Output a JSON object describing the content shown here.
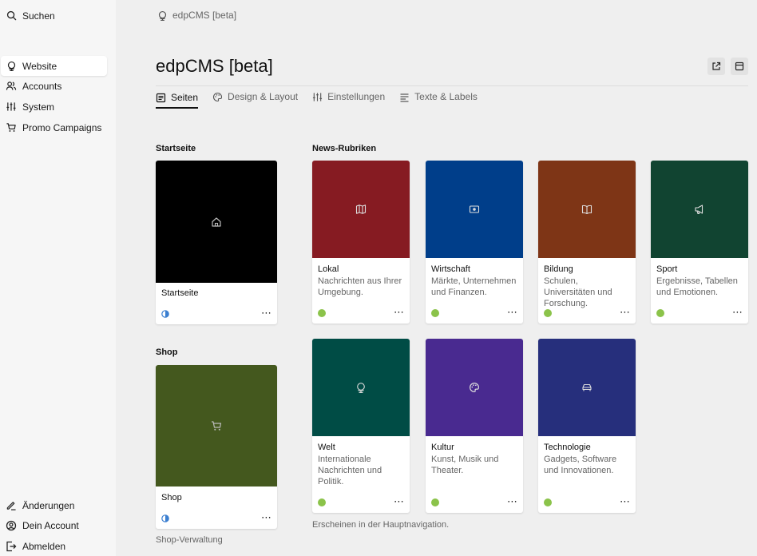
{
  "sidebar": {
    "search_label": "Suchen",
    "items": [
      {
        "label": "Website",
        "icon": "globe-icon",
        "active": true
      },
      {
        "label": "Accounts",
        "icon": "users-icon"
      },
      {
        "label": "System",
        "icon": "sliders-icon"
      },
      {
        "label": "Promo Campaigns",
        "icon": "cart-icon"
      }
    ],
    "bottom": [
      {
        "label": "Änderungen",
        "icon": "pencil-icon"
      },
      {
        "label": "Dein Account",
        "icon": "user-circle-icon"
      },
      {
        "label": "Abmelden",
        "icon": "logout-icon"
      }
    ]
  },
  "breadcrumb": {
    "label": "edpCMS [beta]"
  },
  "header": {
    "title": "edpCMS [beta]"
  },
  "tabs": [
    {
      "label": "Seiten",
      "icon": "page-icon",
      "active": true
    },
    {
      "label": "Design & Layout",
      "icon": "palette-icon"
    },
    {
      "label": "Einstellungen",
      "icon": "sliders-icon"
    },
    {
      "label": "Texte & Labels",
      "icon": "text-icon"
    }
  ],
  "sections": {
    "startseite": {
      "title": "Startseite",
      "card": {
        "name": "Startseite",
        "color": "#000000",
        "icon": "home-icon",
        "status": "half",
        "more": "⋯"
      }
    },
    "shop": {
      "title": "Shop",
      "card": {
        "name": "Shop",
        "color": "#44581e",
        "icon": "cart-icon",
        "status": "half",
        "more": "⋯"
      },
      "note": "Shop-Verwaltung"
    },
    "news": {
      "title": "News-Rubriken",
      "cards": [
        {
          "name": "Lokal",
          "desc": "Nachrichten aus Ihrer Umgebung.",
          "color": "#861b22",
          "icon": "map-icon",
          "more": "⋯"
        },
        {
          "name": "Wirtschaft",
          "desc": "Märkte, Unternehmen und Finanzen.",
          "color": "#003e8a",
          "icon": "money-icon",
          "more": "⋯"
        },
        {
          "name": "Bildung",
          "desc": "Schulen, Universitäten und Forschung.",
          "color": "#7e3516",
          "icon": "book-icon",
          "more": "⋯"
        },
        {
          "name": "Sport",
          "desc": "Ergebnisse, Tabellen und Emotionen.",
          "color": "#114431",
          "icon": "megaphone-icon",
          "more": "⋯"
        },
        {
          "name": "Welt",
          "desc": "Internationale Nachrichten und Politik.",
          "color": "#004c45",
          "icon": "globe-icon",
          "more": "⋯"
        },
        {
          "name": "Kultur",
          "desc": "Kunst, Musik und Theater.",
          "color": "#492a90",
          "icon": "palette-icon",
          "more": "⋯"
        },
        {
          "name": "Technologie",
          "desc": "Gadgets, Software und Innovationen.",
          "color": "#262f7c",
          "icon": "car-icon",
          "more": "⋯"
        }
      ],
      "note": "Erscheinen in der Hauptnavigation."
    }
  },
  "colors": {
    "status_green": "#8bc34a",
    "status_half": "#3b7fd0",
    "accent": "#111111"
  }
}
